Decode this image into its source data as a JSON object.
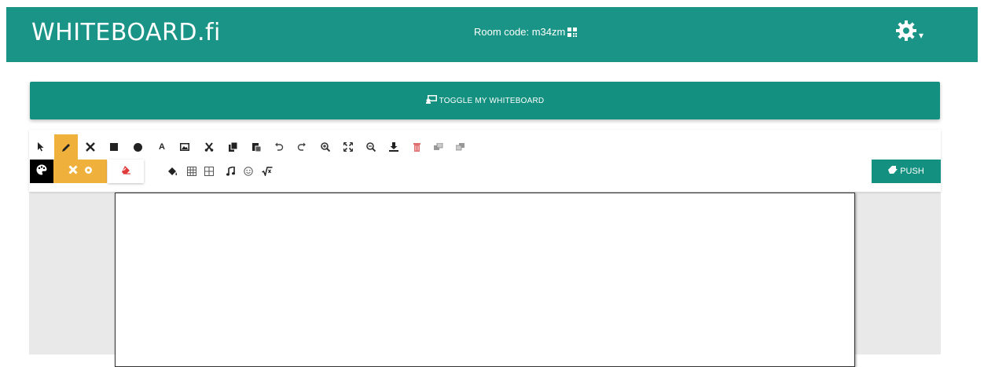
{
  "header": {
    "logo": "WHITEBOARD.fi",
    "room_label": "Room code: m34zm",
    "qr_icon": "qr-code-icon",
    "settings_icon": "gear-icon",
    "caret": "▾"
  },
  "toggle": {
    "label": "TOGGLE MY WHITEBOARD",
    "icon": "chalkboard-icon"
  },
  "toolbar": {
    "row1": [
      {
        "name": "pointer-tool",
        "icon": "cursor-arrow-icon"
      },
      {
        "name": "pen-tool",
        "icon": "pencil-icon",
        "active": true
      },
      {
        "name": "line-tool",
        "icon": "cross-arrows-icon"
      },
      {
        "name": "rectangle-tool",
        "icon": "square-icon"
      },
      {
        "name": "ellipse-tool",
        "icon": "circle-icon"
      },
      {
        "name": "text-tool",
        "icon": "text-a-icon",
        "text": "A"
      },
      {
        "name": "image-tool",
        "icon": "image-icon"
      },
      {
        "name": "cut-tool",
        "icon": "scissors-icon"
      },
      {
        "name": "copy-tool",
        "icon": "copy-icon"
      },
      {
        "name": "paste-tool",
        "icon": "paste-icon"
      },
      {
        "name": "undo-tool",
        "icon": "undo-icon"
      },
      {
        "name": "redo-tool",
        "icon": "redo-icon"
      },
      {
        "name": "zoom-in-tool",
        "icon": "zoom-in-icon"
      },
      {
        "name": "fit-tool",
        "icon": "expand-icon"
      },
      {
        "name": "zoom-out-tool",
        "icon": "zoom-out-icon"
      },
      {
        "name": "download-tool",
        "icon": "download-icon"
      },
      {
        "name": "clear-tool",
        "icon": "trash-icon"
      },
      {
        "name": "bring-front-tool",
        "icon": "layer-up-icon"
      },
      {
        "name": "send-back-tool",
        "icon": "layer-down-icon"
      }
    ],
    "row2": [
      {
        "name": "fill-tool",
        "icon": "paint-bucket-icon"
      },
      {
        "name": "grid-tool",
        "icon": "grid-icon"
      },
      {
        "name": "table-tool",
        "icon": "table-icon"
      },
      {
        "name": "music-tool",
        "icon": "music-note-icon"
      },
      {
        "name": "emoji-tool",
        "icon": "smiley-icon"
      },
      {
        "name": "math-tool",
        "icon": "square-root-icon"
      }
    ],
    "color_icon": "palette-icon",
    "width_icons": [
      "cross-icon",
      "dot-icon"
    ],
    "eraser_icon": "eraser-icon",
    "push_label": "PUSH",
    "push_icon": "push-icon"
  },
  "colors": {
    "brand": "#199486",
    "accent": "#f0b03c",
    "eraser": "#e03a3a"
  }
}
